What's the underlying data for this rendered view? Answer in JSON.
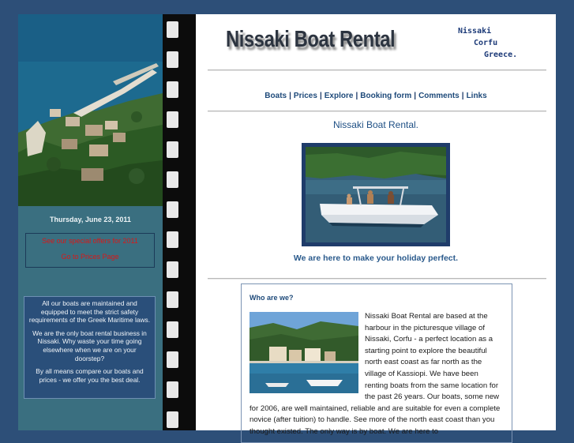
{
  "sidebar": {
    "date": "Thursday, June 23, 2011",
    "special_offers": "See our special offers for 2011",
    "prices_link": "Go to Prices Page",
    "info_paragraphs": [
      "All our boats are maintained and equipped to meet the strict  safety requirements of the Greek Maritime laws.",
      "We are the only boat rental business in Nissaki. Why waste  your time going elsewhere when we are on your doorstep?",
      "By all means compare our boats and prices - we offer you the best deal."
    ]
  },
  "header": {
    "title": "Nissaki Boat Rental",
    "tagline": [
      "Nissaki",
      "Corfu",
      "Greece."
    ]
  },
  "nav": {
    "items": [
      "Boats",
      "Prices",
      "Explore",
      "Booking form",
      "Comments",
      "Links"
    ],
    "separator": "|"
  },
  "main": {
    "heading": "Nissaki Boat Rental.",
    "subheading": "We are here to make your holiday perfect.",
    "who": {
      "title": "Who are we?",
      "text": "Nissaki Boat Rental are based at the harbour in the picturesque village of Nissaki, Corfu - a perfect location as a starting point to explore the beautiful north east coast as far north as the village of Kassiopi. We have been renting boats from the same location for the past 26 years. Our boats, some new for 2006, are well maintained, reliable and are suitable for even a complete novice (after tuition) to handle. See more of the north east coast than you thought existed. The only way is by boat. We are here to"
    }
  },
  "colors": {
    "page_background": "#2d4f78",
    "sidebar": "#3a6f80",
    "link": "#1e4a7a",
    "alert_red": "#d81818"
  }
}
